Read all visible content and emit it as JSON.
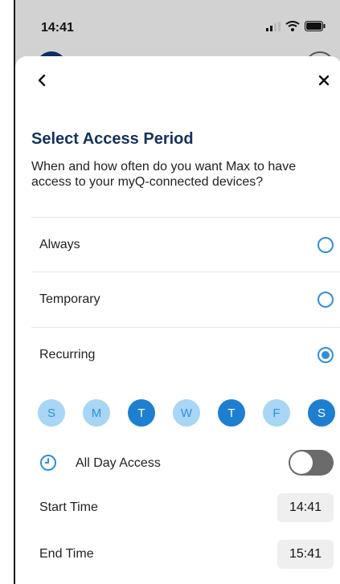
{
  "status": {
    "time": "14:41"
  },
  "header": {
    "title": "Select Access Period",
    "description": "When and how often do you want Max to have access to your myQ-connected devices?"
  },
  "options": [
    {
      "label": "Always",
      "selected": false
    },
    {
      "label": "Temporary",
      "selected": false
    },
    {
      "label": "Recurring",
      "selected": true
    }
  ],
  "days": [
    {
      "label": "S",
      "active": false
    },
    {
      "label": "M",
      "active": false
    },
    {
      "label": "T",
      "active": true
    },
    {
      "label": "W",
      "active": false
    },
    {
      "label": "T",
      "active": true
    },
    {
      "label": "F",
      "active": false
    },
    {
      "label": "S",
      "active": true
    }
  ],
  "all_day": {
    "label": "All Day Access",
    "enabled": false
  },
  "start_time": {
    "label": "Start Time",
    "value": "14:41"
  },
  "end_time": {
    "label": "End Time",
    "value": "15:41"
  },
  "colors": {
    "accent": "#2f8fdc",
    "title": "#14325e",
    "day_active": "#1e7fd0",
    "day_inactive": "#a8d6f4"
  },
  "icons": {
    "back": "chevron-left-icon",
    "close": "close-icon",
    "clock": "clock-icon"
  }
}
